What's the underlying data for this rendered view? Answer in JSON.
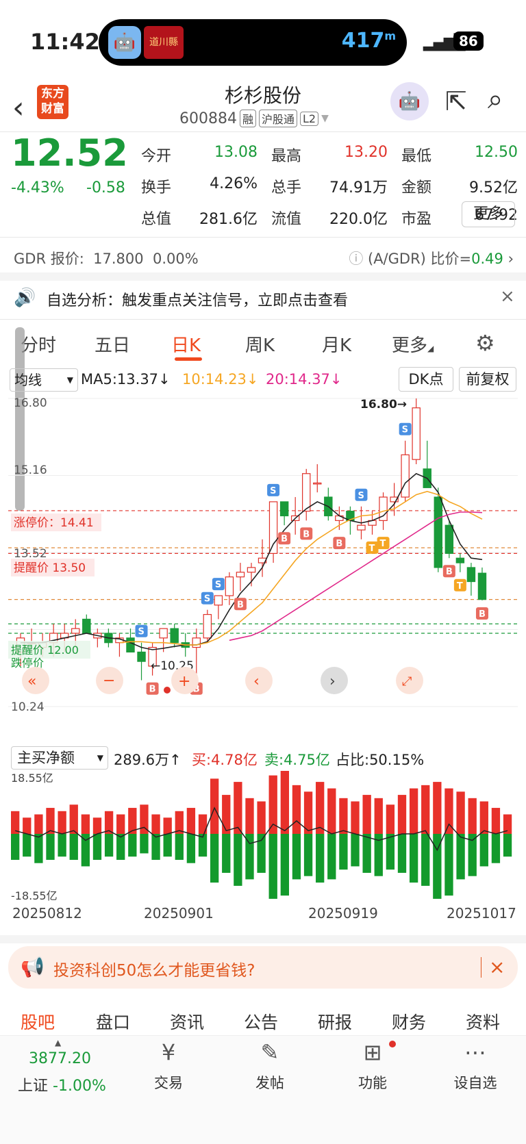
{
  "status": {
    "time": "11:42",
    "island_num": "417",
    "island_unit": "m",
    "battery": "86",
    "island_app_text": "道川縣"
  },
  "header": {
    "logo": "东方财富",
    "title": "杉杉股份",
    "code": "600884",
    "tags": [
      "融",
      "沪股通",
      "L2"
    ]
  },
  "quote": {
    "price": "12.52",
    "change_pct": "-4.43%",
    "change": "-0.58",
    "rows": [
      [
        {
          "label": "今开",
          "value": "13.08",
          "color": "green"
        },
        {
          "label": "最高",
          "value": "13.20",
          "color": "red"
        },
        {
          "label": "最低",
          "value": "12.50",
          "color": "green"
        }
      ],
      [
        {
          "label": "换手",
          "value": "4.26%",
          "color": ""
        },
        {
          "label": "总手",
          "value": "74.91万",
          "color": ""
        },
        {
          "label": "金额",
          "value": "9.52亿",
          "color": ""
        }
      ],
      [
        {
          "label": "总值",
          "value": "281.6亿",
          "color": ""
        },
        {
          "label": "流值",
          "value": "220.0亿",
          "color": ""
        },
        {
          "label": "市盈",
          "value": "67.92",
          "color": ""
        }
      ]
    ],
    "more": "更多"
  },
  "gdr": {
    "label": "GDR 报价:",
    "price": "17.800",
    "pct": "0.00%",
    "ratio_label": "(A/GDR) 比价=",
    "ratio": "0.49"
  },
  "notice": {
    "text": "自选分析：触发重点关注信号，立即点击查看"
  },
  "tabs": [
    "分时",
    "五日",
    "日K",
    "周K",
    "月K",
    "更多"
  ],
  "ma": {
    "select": "均线",
    "ma5": "MA5:13.37↓",
    "ma10": "10:14.23↓",
    "ma20": "20:14.37↓",
    "dk": "DK点",
    "adjust": "前复权"
  },
  "kline_labels": {
    "top": "16.80",
    "y2": "15.16",
    "y3": "13.52",
    "bottom": "10.24",
    "max_tag": "16.80→",
    "min_tag": "←10.25",
    "limit_up": "涨停价：14.41",
    "remind": "提醒价 13.50",
    "line_a": "提醒价 12.00",
    "line_b": "跌停价"
  },
  "chart_data": {
    "type": "candlestick",
    "ylim": [
      10.24,
      16.8
    ],
    "candles": [
      {
        "o": 11.4,
        "h": 11.8,
        "l": 11.1,
        "c": 11.7
      },
      {
        "o": 11.6,
        "h": 11.9,
        "l": 11.4,
        "c": 11.6
      },
      {
        "o": 11.5,
        "h": 11.8,
        "l": 11.3,
        "c": 11.6
      },
      {
        "o": 11.6,
        "h": 12.0,
        "l": 11.3,
        "c": 11.8
      },
      {
        "o": 11.7,
        "h": 12.0,
        "l": 11.4,
        "c": 11.8
      },
      {
        "o": 11.8,
        "h": 12.1,
        "l": 11.5,
        "c": 11.9
      },
      {
        "o": 12.1,
        "h": 12.2,
        "l": 11.8,
        "c": 11.8
      },
      {
        "o": 11.7,
        "h": 11.9,
        "l": 11.5,
        "c": 11.8
      },
      {
        "o": 11.8,
        "h": 11.9,
        "l": 11.5,
        "c": 11.6
      },
      {
        "o": 11.6,
        "h": 11.8,
        "l": 11.3,
        "c": 11.7
      },
      {
        "o": 11.7,
        "h": 11.9,
        "l": 11.4,
        "c": 11.4
      },
      {
        "o": 11.4,
        "h": 11.6,
        "l": 10.8,
        "c": 11.2
      },
      {
        "o": 11.1,
        "h": 11.6,
        "l": 10.9,
        "c": 11.5
      },
      {
        "o": 11.7,
        "h": 11.9,
        "l": 11.4,
        "c": 11.9
      },
      {
        "o": 11.9,
        "h": 12.0,
        "l": 11.5,
        "c": 11.6
      },
      {
        "o": 11.6,
        "h": 11.8,
        "l": 11.3,
        "c": 11.5
      },
      {
        "o": 11.5,
        "h": 11.9,
        "l": 10.9,
        "c": 11.7
      },
      {
        "o": 11.7,
        "h": 12.3,
        "l": 11.6,
        "c": 12.2
      },
      {
        "o": 12.4,
        "h": 12.6,
        "l": 12.1,
        "c": 12.6
      },
      {
        "o": 12.6,
        "h": 13.1,
        "l": 12.4,
        "c": 13.0
      },
      {
        "o": 13.0,
        "h": 13.3,
        "l": 12.7,
        "c": 13.1
      },
      {
        "o": 13.1,
        "h": 13.3,
        "l": 12.8,
        "c": 13.2
      },
      {
        "o": 13.3,
        "h": 13.8,
        "l": 13.0,
        "c": 13.4
      },
      {
        "o": 13.5,
        "h": 14.6,
        "l": 13.3,
        "c": 14.6
      },
      {
        "o": 14.6,
        "h": 14.6,
        "l": 14.1,
        "c": 14.3
      },
      {
        "o": 14.2,
        "h": 14.7,
        "l": 13.9,
        "c": 14.3
      },
      {
        "o": 14.4,
        "h": 15.3,
        "l": 14.2,
        "c": 15.2
      },
      {
        "o": 15.0,
        "h": 15.4,
        "l": 14.8,
        "c": 15.0
      },
      {
        "o": 14.7,
        "h": 14.9,
        "l": 14.2,
        "c": 14.3
      },
      {
        "o": 14.2,
        "h": 14.5,
        "l": 14.0,
        "c": 14.3
      },
      {
        "o": 14.4,
        "h": 14.5,
        "l": 13.9,
        "c": 14.2
      },
      {
        "o": 14.0,
        "h": 14.5,
        "l": 13.8,
        "c": 14.1
      },
      {
        "o": 14.1,
        "h": 14.4,
        "l": 13.9,
        "c": 14.2
      },
      {
        "o": 14.2,
        "h": 14.8,
        "l": 14.0,
        "c": 14.7
      },
      {
        "o": 14.6,
        "h": 15.0,
        "l": 14.3,
        "c": 14.7
      },
      {
        "o": 14.7,
        "h": 15.9,
        "l": 14.6,
        "c": 15.6
      },
      {
        "o": 15.5,
        "h": 16.8,
        "l": 15.4,
        "c": 16.6
      },
      {
        "o": 15.3,
        "h": 15.9,
        "l": 14.9,
        "c": 14.9
      },
      {
        "o": 14.7,
        "h": 14.9,
        "l": 13.1,
        "c": 13.2
      },
      {
        "o": 14.1,
        "h": 14.2,
        "l": 13.4,
        "c": 13.5
      },
      {
        "o": 13.4,
        "h": 13.5,
        "l": 13.1,
        "c": 13.3
      },
      {
        "o": 13.2,
        "h": 13.3,
        "l": 12.6,
        "c": 12.9
      },
      {
        "o": 13.08,
        "h": 13.2,
        "l": 12.5,
        "c": 12.52
      }
    ],
    "ma5": [
      11.6,
      11.6,
      11.6,
      11.65,
      11.7,
      11.75,
      11.8,
      11.75,
      11.7,
      11.68,
      11.6,
      11.5,
      11.45,
      11.48,
      11.52,
      11.55,
      11.55,
      11.62,
      11.9,
      12.3,
      12.65,
      12.9,
      13.2,
      13.7,
      14.0,
      14.25,
      14.45,
      14.6,
      14.5,
      14.3,
      14.2,
      14.15,
      14.2,
      14.3,
      14.55,
      15.0,
      15.2,
      15.1,
      14.8,
      14.2,
      13.7,
      13.4,
      13.37
    ],
    "ma10": [
      null,
      null,
      null,
      null,
      null,
      null,
      null,
      null,
      null,
      11.6,
      11.62,
      11.62,
      11.6,
      11.6,
      11.58,
      11.55,
      11.55,
      11.6,
      11.7,
      11.85,
      12.05,
      12.25,
      12.45,
      12.75,
      13.05,
      13.35,
      13.6,
      13.8,
      13.95,
      14.1,
      14.22,
      14.3,
      14.32,
      14.4,
      14.45,
      14.6,
      14.75,
      14.82,
      14.75,
      14.6,
      14.5,
      14.35,
      14.23
    ],
    "ma20": [
      null,
      null,
      null,
      null,
      null,
      null,
      null,
      null,
      null,
      null,
      null,
      null,
      null,
      null,
      null,
      null,
      null,
      null,
      null,
      11.65,
      11.7,
      11.75,
      11.85,
      12.0,
      12.15,
      12.3,
      12.45,
      12.6,
      12.75,
      12.9,
      13.05,
      13.2,
      13.35,
      13.5,
      13.65,
      13.8,
      13.95,
      14.1,
      14.25,
      14.33,
      14.38,
      14.38,
      14.37
    ]
  },
  "indicator": {
    "select": "主买净额",
    "value": "289.6万↑",
    "buy": "买:4.78亿",
    "sell": "卖:4.75亿",
    "ratio": "占比:50.15%",
    "top": "18.55亿",
    "bottom": "-18.55亿",
    "flow_chart": {
      "type": "bar",
      "ylim": [
        -18.55,
        18.55
      ],
      "buy": [
        7,
        5,
        6,
        8,
        7,
        9,
        6,
        5,
        7,
        6,
        8,
        9,
        6,
        5,
        7,
        8,
        6,
        17,
        12,
        16,
        11,
        10,
        18,
        20,
        15,
        13,
        16,
        14,
        11,
        10,
        12,
        11,
        9,
        12,
        14,
        15,
        16,
        14,
        13,
        11,
        10,
        8,
        6
      ],
      "sell": [
        -8,
        -7,
        -9,
        -8,
        -7,
        -8,
        -10,
        -8,
        -7,
        -8,
        -7,
        -6,
        -8,
        -7,
        -8,
        -9,
        -7,
        -15,
        -12,
        -16,
        -14,
        -12,
        -20,
        -19,
        -14,
        -13,
        -15,
        -14,
        -11,
        -10,
        -12,
        -13,
        -11,
        -12,
        -15,
        -16,
        -20,
        -19,
        -14,
        -13,
        -10,
        -9,
        -7
      ],
      "net": [
        1,
        0,
        -1,
        1,
        0,
        1,
        -2,
        0,
        1,
        -1,
        1,
        2,
        -1,
        0,
        1,
        0,
        -1,
        8,
        1,
        2,
        -3,
        -2,
        3,
        1,
        4,
        1,
        2,
        0,
        1,
        0,
        -1,
        -2,
        -1,
        0,
        0,
        1,
        -5,
        3,
        -1,
        -2,
        1,
        0,
        1
      ]
    },
    "dates": [
      "20250812",
      "20250901",
      "20250919",
      "20251017"
    ]
  },
  "ad": {
    "text": "投资科创50怎么才能更省钱?"
  },
  "bottom_tabs": [
    "股吧",
    "盘口",
    "资讯",
    "公告",
    "研报",
    "财务",
    "资料"
  ],
  "nav": {
    "index_value": "3877.20",
    "index_name": "上证",
    "index_change": "-1.00%",
    "items": [
      "交易",
      "发帖",
      "功能",
      "设自选"
    ]
  }
}
